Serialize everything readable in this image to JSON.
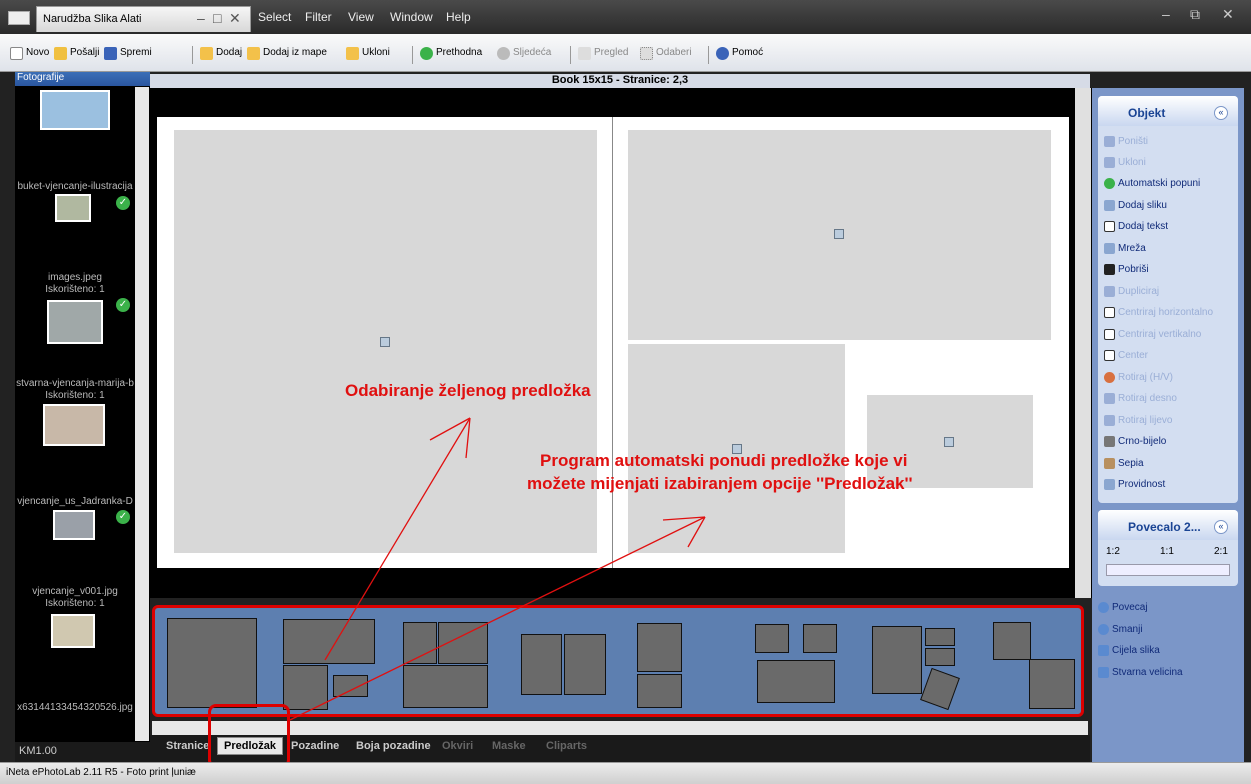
{
  "titlebar": {
    "tab_label": "Narudžba  Slika  Alati",
    "menu": [
      "Select",
      "Filter",
      "View",
      "Window",
      "Help"
    ]
  },
  "toolbar": {
    "items": [
      {
        "label": "Novo",
        "icon": "new-file-icon"
      },
      {
        "label": "Pošalji",
        "icon": "send-icon"
      },
      {
        "label": "Spremi",
        "icon": "save-icon"
      },
      {
        "label": "Dodaj",
        "icon": "add-folder-icon"
      },
      {
        "label": "Dodaj iz mape",
        "icon": "folder-icon"
      },
      {
        "label": "Ukloni",
        "icon": "remove-folder-icon"
      },
      {
        "label": "Prethodna",
        "icon": "previous-icon"
      },
      {
        "label": "Sljedeća",
        "icon": "next-icon"
      },
      {
        "label": "Pregled",
        "icon": "pointer-icon"
      },
      {
        "label": "Odaberi",
        "icon": "select-icon"
      },
      {
        "label": "Pomoć",
        "icon": "help-icon"
      }
    ]
  },
  "book_title": "Book 15x15 - Stranice: 2,3",
  "left_panel": {
    "header": "Fotografije",
    "price": "KM1.00",
    "thumbs": [
      {
        "caption": "buket-vjencanje-ilustracija"
      },
      {
        "caption": "images.jpeg",
        "used": "Iskorišteno: 1"
      },
      {
        "caption": "stvarna-vjencanja-marija-b",
        "used": "Iskorišteno: 1"
      },
      {
        "caption": "vjencanje_us_Jadranka-D"
      },
      {
        "caption": "vjencanje_v001.jpg",
        "used": "Iskorišteno: 1"
      },
      {
        "caption": "x63144133454320526.jpg"
      }
    ]
  },
  "annotations": {
    "a1": "Odabiranje željenog predložka",
    "a2": "Program automatski ponudi predložke koje vi",
    "a3": "možete mijenjati izabiranjem opcije ''Predložak''"
  },
  "tabs": [
    {
      "label": "Stranice"
    },
    {
      "label": "Predložak"
    },
    {
      "label": "Pozadine"
    },
    {
      "label": "Boja pozadine"
    },
    {
      "label": "Okviri"
    },
    {
      "label": "Maske"
    },
    {
      "label": "Cliparts"
    }
  ],
  "right_panel": {
    "objekt_title": "Objekt",
    "objekt_items": [
      "Poništi",
      "Ukloni",
      "Automatski popuni",
      "Dodaj sliku",
      "Dodaj tekst",
      "Mreža",
      "Pobriši",
      "Dupliciraj",
      "Centriraj horizontalno",
      "Centriraj vertikalno",
      "Center",
      "Rotiraj (H/V)",
      "Rotiraj desno",
      "Rotiraj lijevo",
      "Crno-bijelo",
      "Sepia",
      "Providnost"
    ],
    "zoom_title": "Povecalo 2...",
    "zoom_levels": [
      "1:2",
      "1:1",
      "2:1"
    ],
    "view_items": [
      "Povecaj",
      "Smanji",
      "Cijela slika",
      "Stvarna velicina"
    ]
  },
  "status": "iNeta ePhotoLab 2.11 R5 - Foto print ļuniæ",
  "colors": {
    "accent": "#1a4494",
    "annotation": "#e01010",
    "strip": "#5d7fb0"
  }
}
